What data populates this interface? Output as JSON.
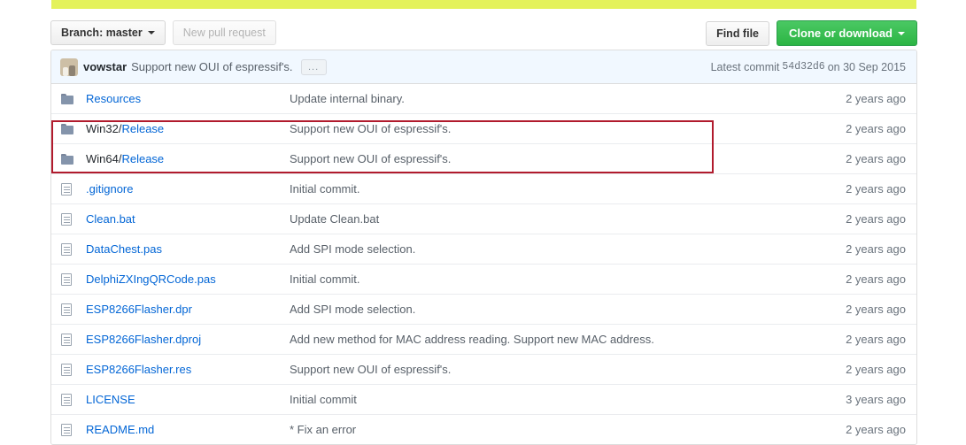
{
  "toolbar": {
    "branch_prefix": "Branch:",
    "branch_name": "master",
    "new_pull_request": "New pull request",
    "find_file": "Find file",
    "clone_or_download": "Clone or download"
  },
  "commit_header": {
    "author": "vowstar",
    "message": "Support new OUI of espressif's.",
    "expand_label": "...",
    "latest_commit_prefix": "Latest commit",
    "sha": "54d32d6",
    "date_prefix": "on",
    "date": "30 Sep 2015"
  },
  "files": [
    {
      "type": "folder",
      "name": "Resources",
      "dir_prefix": "",
      "link_part": "Resources",
      "message": "Update internal binary.",
      "age": "2 years ago"
    },
    {
      "type": "folder",
      "name": "Win32/Release",
      "dir_prefix": "Win32/",
      "link_part": "Release",
      "message": "Support new OUI of espressif's.",
      "age": "2 years ago"
    },
    {
      "type": "folder",
      "name": "Win64/Release",
      "dir_prefix": "Win64/",
      "link_part": "Release",
      "message": "Support new OUI of espressif's.",
      "age": "2 years ago"
    },
    {
      "type": "file",
      "name": ".gitignore",
      "dir_prefix": "",
      "link_part": ".gitignore",
      "message": "Initial commit.",
      "age": "2 years ago"
    },
    {
      "type": "file",
      "name": "Clean.bat",
      "dir_prefix": "",
      "link_part": "Clean.bat",
      "message": "Update Clean.bat",
      "age": "2 years ago"
    },
    {
      "type": "file",
      "name": "DataChest.pas",
      "dir_prefix": "",
      "link_part": "DataChest.pas",
      "message": "Add SPI mode selection.",
      "age": "2 years ago"
    },
    {
      "type": "file",
      "name": "DelphiZXIngQRCode.pas",
      "dir_prefix": "",
      "link_part": "DelphiZXIngQRCode.pas",
      "message": "Initial commit.",
      "age": "2 years ago"
    },
    {
      "type": "file",
      "name": "ESP8266Flasher.dpr",
      "dir_prefix": "",
      "link_part": "ESP8266Flasher.dpr",
      "message": "Add SPI mode selection.",
      "age": "2 years ago"
    },
    {
      "type": "file",
      "name": "ESP8266Flasher.dproj",
      "dir_prefix": "",
      "link_part": "ESP8266Flasher.dproj",
      "message": "Add new method for MAC address reading. Support new MAC address.",
      "age": "2 years ago"
    },
    {
      "type": "file",
      "name": "ESP8266Flasher.res",
      "dir_prefix": "",
      "link_part": "ESP8266Flasher.res",
      "message": "Support new OUI of espressif's.",
      "age": "2 years ago"
    },
    {
      "type": "file",
      "name": "LICENSE",
      "dir_prefix": "",
      "link_part": "LICENSE",
      "message": "Initial commit",
      "age": "3 years ago"
    },
    {
      "type": "file",
      "name": "README.md",
      "dir_prefix": "",
      "link_part": "README.md",
      "message": "* Fix an error",
      "age": "2 years ago"
    }
  ],
  "colors": {
    "highlight_bar": "#e4f25b",
    "annotation": "#b11b2d",
    "link": "#0366d6",
    "clone_button": "#2cb544",
    "commit_header_bg": "#f1f8ff"
  }
}
